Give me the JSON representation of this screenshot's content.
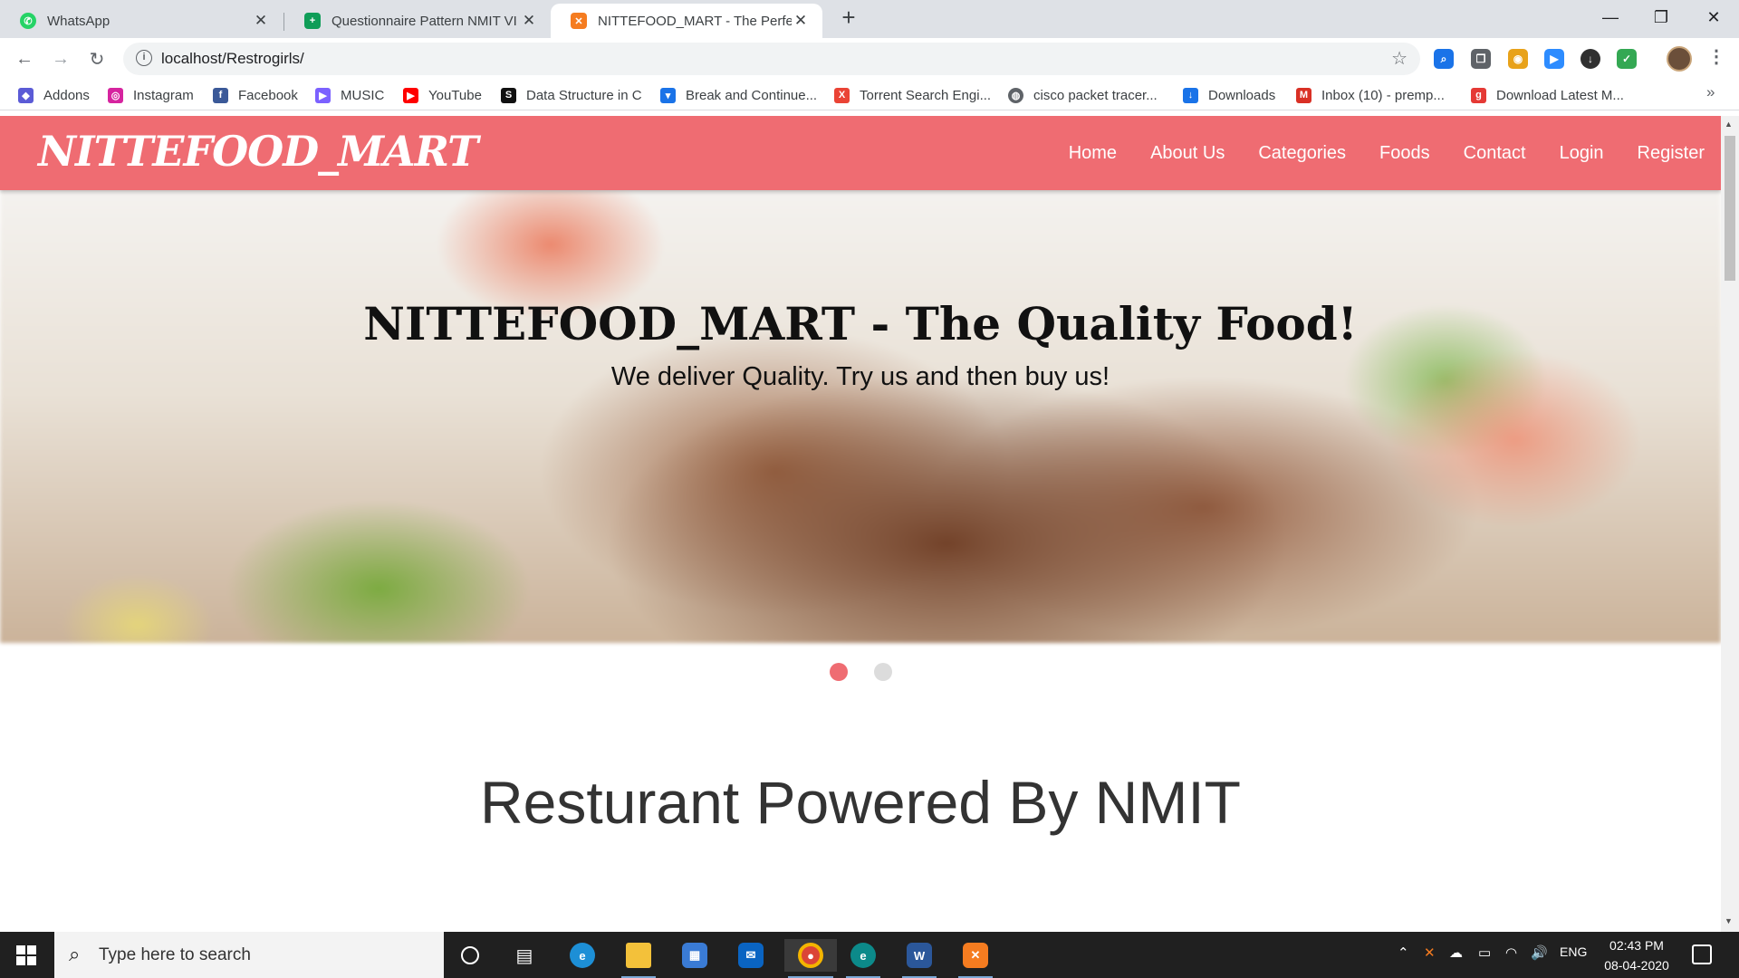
{
  "browser": {
    "tabs": [
      {
        "title": "WhatsApp",
        "favicon_color": "#25d366",
        "glyph": "✆",
        "active": false
      },
      {
        "title": "Questionnaire Pattern NMIT VI Se",
        "favicon_color": "#0f9d58",
        "glyph": "+",
        "active": false
      },
      {
        "title": "NITTEFOOD_MART - The Perfect",
        "favicon_color": "#f57c20",
        "glyph": "✕",
        "active": true
      }
    ],
    "new_tab": "+",
    "window_controls": {
      "minimize": "—",
      "maximize": "❐",
      "close": "✕"
    },
    "url": "localhost/Restrogirls/",
    "bookmarks": [
      {
        "label": "Addons",
        "color": "#5b5bd6",
        "glyph": "◆"
      },
      {
        "label": "Instagram",
        "color": "#d6249f",
        "glyph": "◎"
      },
      {
        "label": "Facebook",
        "color": "#3b5998",
        "glyph": "f"
      },
      {
        "label": "MUSIC",
        "color": "#7b61ff",
        "glyph": "▶"
      },
      {
        "label": "YouTube",
        "color": "#ff0000",
        "glyph": "▶"
      },
      {
        "label": "Data Structure in C",
        "color": "#111111",
        "glyph": "S"
      },
      {
        "label": "Break and Continue...",
        "color": "#1a73e8",
        "glyph": "▾"
      },
      {
        "label": "Torrent Search Engi...",
        "color": "#ea4335",
        "glyph": "X"
      },
      {
        "label": "cisco packet tracer...",
        "color": "#5f6368",
        "glyph": "◍"
      },
      {
        "label": "Downloads",
        "color": "#1a73e8",
        "glyph": "↓"
      },
      {
        "label": "Inbox (10) - premp...",
        "color": "#d93025",
        "glyph": "M"
      },
      {
        "label": "Download Latest M...",
        "color": "#e53935",
        "glyph": "g"
      }
    ],
    "bookmarks_more": "»"
  },
  "page": {
    "brand": "NITTEFOOD_MART",
    "nav": [
      "Home",
      "About Us",
      "Categories",
      "Foods",
      "Contact",
      "Login",
      "Register"
    ],
    "hero_title": "NITTEFOOD_MART - The Quality Food!",
    "hero_subtitle": "We deliver Quality. Try us and then buy us!",
    "carousel": {
      "slides": 2,
      "active": 1
    },
    "section_heading": "Resturant Powered By NMIT",
    "colors": {
      "navbar": "#ef6c72",
      "dot_active": "#ef6c72",
      "dot_inactive": "#dcdcdc"
    }
  },
  "taskbar": {
    "search_placeholder": "Type here to search",
    "language": "ENG",
    "time": "02:43 PM",
    "date": "08-04-2020"
  }
}
